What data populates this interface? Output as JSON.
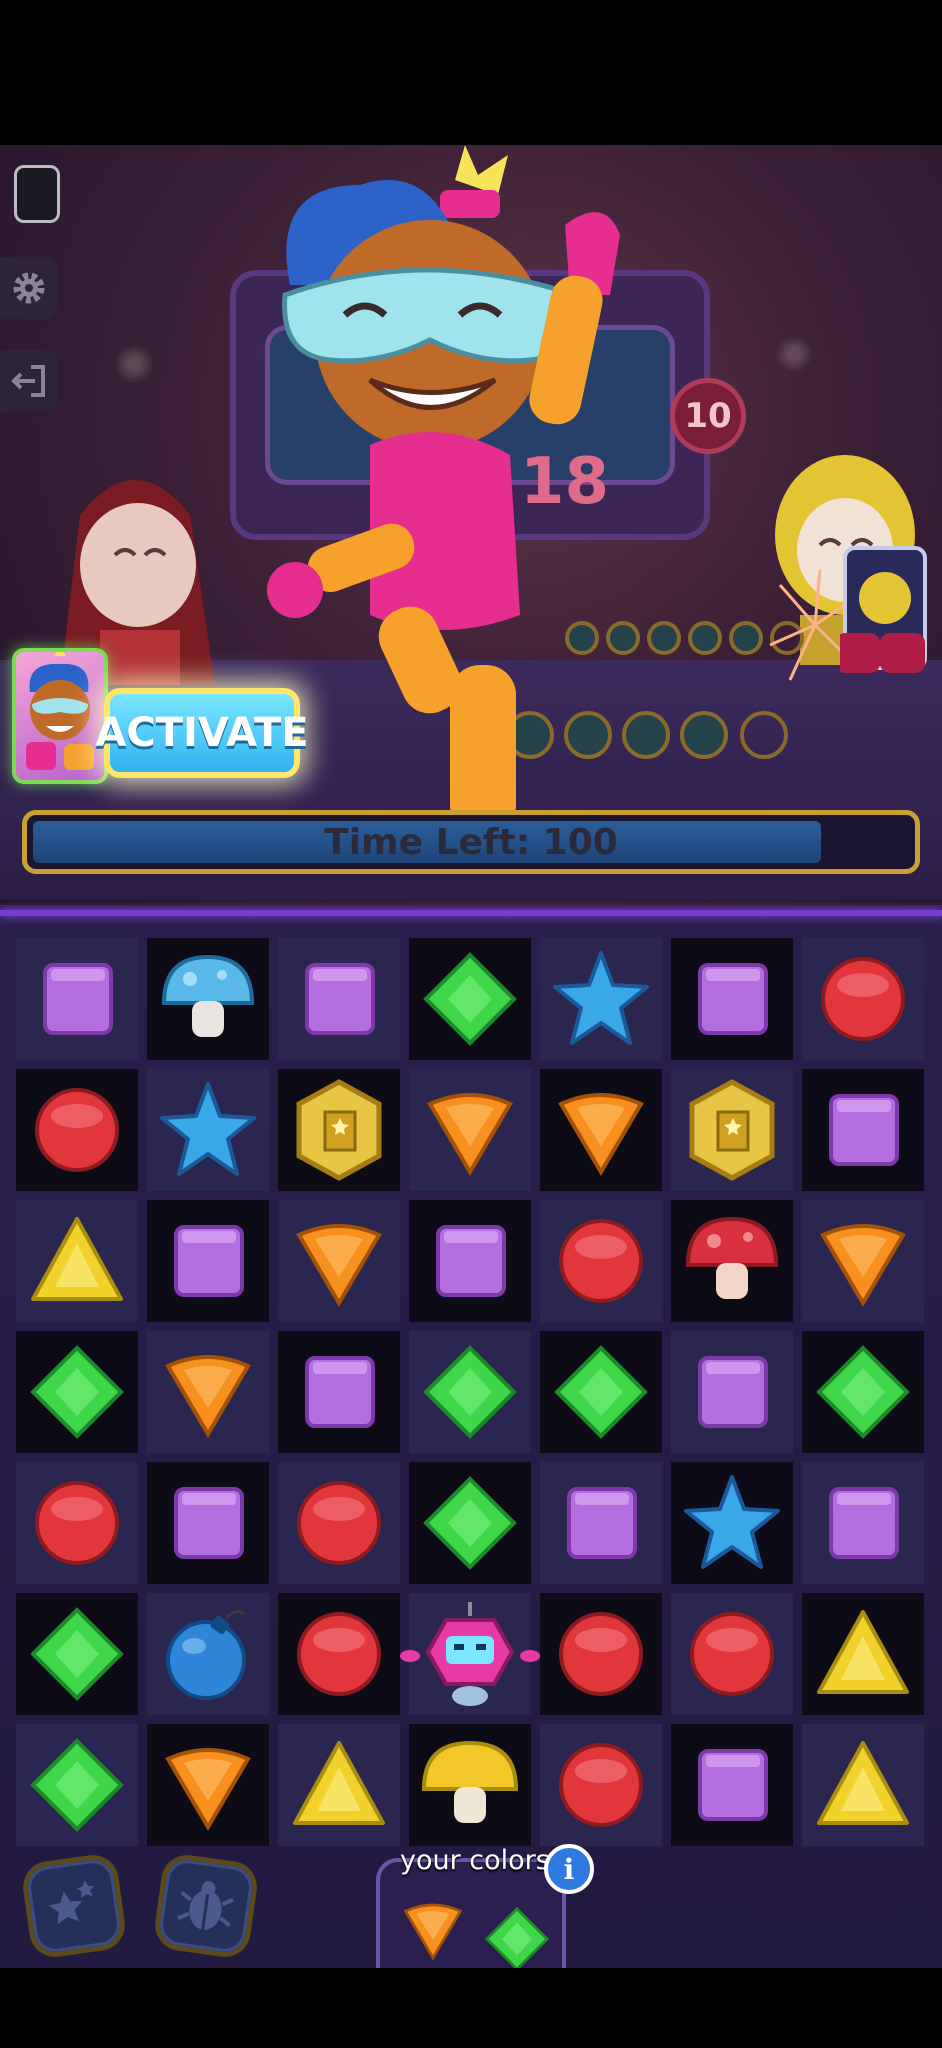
{
  "game": {
    "activate_label": "ACTIVATE",
    "timer_label": "Time Left: 100",
    "timer_fraction": 0.9,
    "stage_score": "18",
    "round_badge": "10",
    "colors_label": "your colors",
    "info_icon_label": "i"
  },
  "icons": {
    "settings": "gear-icon",
    "exit": "exit-icon",
    "booster_1": "stars-icon",
    "booster_2": "scarab-icon"
  },
  "colors": {
    "purple": "#b46ee0",
    "blue": "#3aa8e8",
    "green": "#3fd64a",
    "red": "#e0363c",
    "orange": "#f7901e",
    "yellow": "#f2d12a",
    "gold": "#e7c545",
    "timer_border": "#caa034",
    "activate_glow": "#ffe76a"
  },
  "board": {
    "rows": [
      [
        "purple-square",
        "blue-mushroom",
        "purple-square",
        "green-diamond",
        "blue-star",
        "purple-square",
        "red-circle"
      ],
      [
        "red-circle",
        "blue-star",
        "gold-coin",
        "orange-gem",
        "orange-gem",
        "gold-coin",
        "purple-square"
      ],
      [
        "yellow-triangle",
        "purple-square",
        "orange-gem",
        "purple-square",
        "red-circle",
        "red-mushroom",
        "orange-gem"
      ],
      [
        "green-diamond",
        "orange-gem",
        "purple-square",
        "green-diamond",
        "green-diamond",
        "purple-square",
        "green-diamond"
      ],
      [
        "red-circle",
        "purple-square",
        "red-circle",
        "green-diamond",
        "purple-square",
        "blue-star",
        "purple-square"
      ],
      [
        "green-diamond",
        "blue-bomb",
        "red-circle",
        "pink-robot",
        "red-circle",
        "red-circle",
        "yellow-triangle"
      ],
      [
        "green-diamond",
        "orange-gem",
        "yellow-triangle",
        "yellow-mushroom",
        "red-circle",
        "purple-square",
        "yellow-triangle"
      ]
    ]
  },
  "your_colors": [
    "orange-gem",
    "green-diamond"
  ]
}
